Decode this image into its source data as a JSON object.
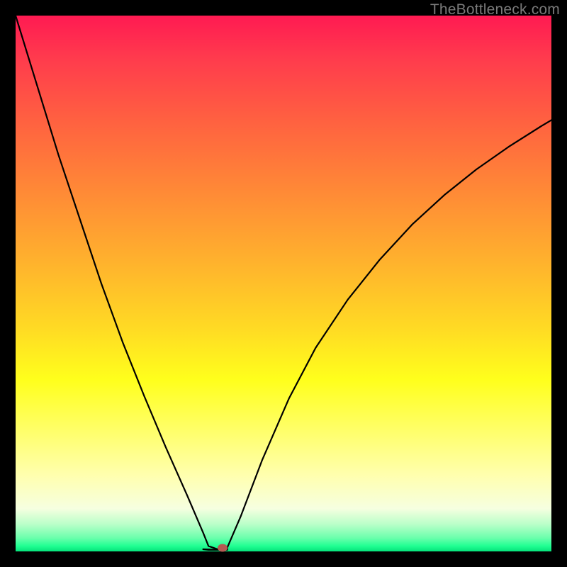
{
  "watermark": "TheBottleneck.com",
  "marker": {
    "x_frac": 0.386,
    "y_frac": 0.994
  },
  "chart_data": {
    "type": "line",
    "title": "",
    "xlabel": "",
    "ylabel": "",
    "xlim": [
      0,
      1
    ],
    "ylim": [
      0,
      1
    ],
    "annotations": [
      "TheBottleneck.com"
    ],
    "gradient_meaning": "vertical color gradient from red (high bottleneck) at top to green (no bottleneck) at bottom",
    "series": [
      {
        "name": "left-branch",
        "x": [
          0.0,
          0.04,
          0.08,
          0.12,
          0.16,
          0.2,
          0.24,
          0.28,
          0.32,
          0.35,
          0.36,
          0.38
        ],
        "y": [
          1.0,
          0.87,
          0.74,
          0.62,
          0.5,
          0.39,
          0.29,
          0.195,
          0.105,
          0.035,
          0.01,
          0.003
        ]
      },
      {
        "name": "valley-flat",
        "x": [
          0.35,
          0.36,
          0.38,
          0.395
        ],
        "y": [
          0.004,
          0.003,
          0.003,
          0.003
        ]
      },
      {
        "name": "right-branch",
        "x": [
          0.395,
          0.42,
          0.46,
          0.51,
          0.56,
          0.62,
          0.68,
          0.74,
          0.8,
          0.86,
          0.92,
          0.98,
          1.0
        ],
        "y": [
          0.007,
          0.065,
          0.17,
          0.285,
          0.38,
          0.47,
          0.545,
          0.61,
          0.665,
          0.713,
          0.755,
          0.793,
          0.805
        ]
      }
    ],
    "marker_point": {
      "x": 0.386,
      "y": 0.006,
      "color": "#b55a52"
    }
  }
}
